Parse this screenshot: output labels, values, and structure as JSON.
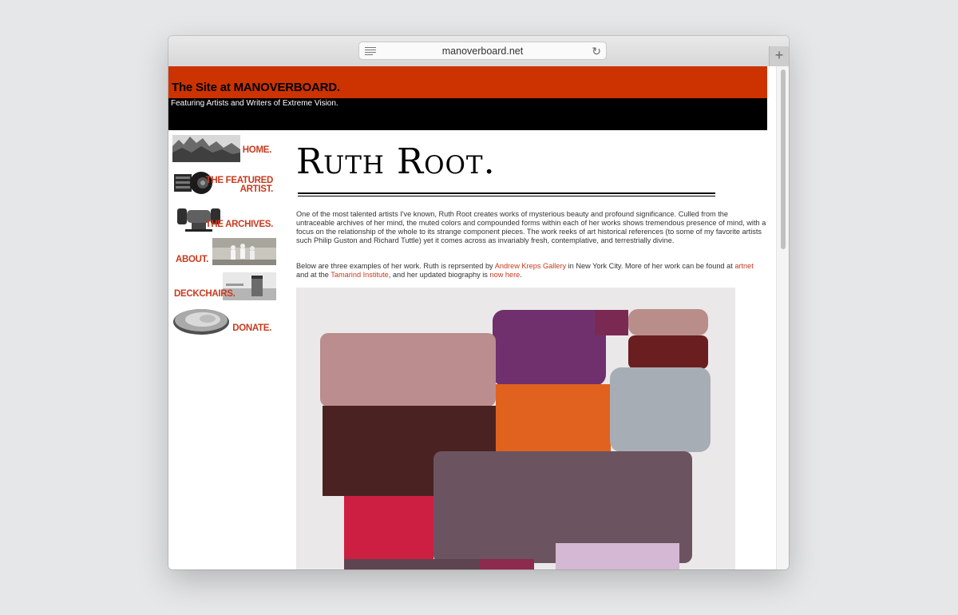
{
  "browser": {
    "url": "manoverboard.net"
  },
  "site": {
    "title": "The Site at MANOVERBOARD.",
    "tagline": "Featuring Artists and Writers of Extreme Vision."
  },
  "nav": {
    "home": "HOME.",
    "featured_line1": "THE FEATURED",
    "featured_line2": "ARTIST.",
    "archives": "THE ARCHIVES.",
    "about": "ABOUT.",
    "deckchairs": "DECKCHAIRS.",
    "donate": "DONATE."
  },
  "article": {
    "title": "Ruth Root.",
    "intro": "One of the most talented artists I've known, Ruth Root creates works of mysterious beauty and profound significance. Culled from the untraceable archives of her mind, the muted colors and compounded forms within each of her works shows tremendous presence of mind, with a focus on the relationship of the whole to its strange component pieces. The work reeks of art historical references (to some of my favorite artists such Philip Guston and Richard Tuttle) yet it comes across as invariably fresh, contemplative, and terrestrially divine.",
    "p2_text1": "Below are three examples of her work. Ruth is reprsented by ",
    "p2_link1": "Andrew Kreps Gallery",
    "p2_text2": " in New York City. More of her work can be found at ",
    "p2_link2": "artnet",
    "p2_text3": " and at the ",
    "p2_link3": "Tamarind Institute",
    "p2_text4": ", and her updated biography is ",
    "p2_link4": "now here",
    "p2_text5": "."
  },
  "colors": {
    "header_red": "#cc3300",
    "nav_red": "#c83a1e",
    "link_red": "#c83a1e"
  },
  "icons": [
    "reader-icon",
    "reload-icon",
    "plus-icon"
  ]
}
